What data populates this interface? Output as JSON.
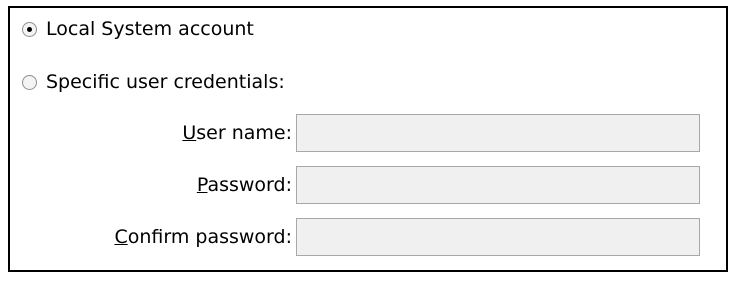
{
  "account": {
    "options": [
      {
        "label": "Local System account",
        "selected": true
      },
      {
        "label": "Specific user credentials:",
        "selected": false
      }
    ],
    "fields": [
      {
        "label": "User name:",
        "accelerator_index": 0,
        "value": "",
        "enabled": false
      },
      {
        "label": "Password:",
        "accelerator_index": 0,
        "value": "",
        "enabled": false
      },
      {
        "label": "Confirm password:",
        "accelerator_index": 0,
        "value": "",
        "enabled": false
      }
    ]
  }
}
